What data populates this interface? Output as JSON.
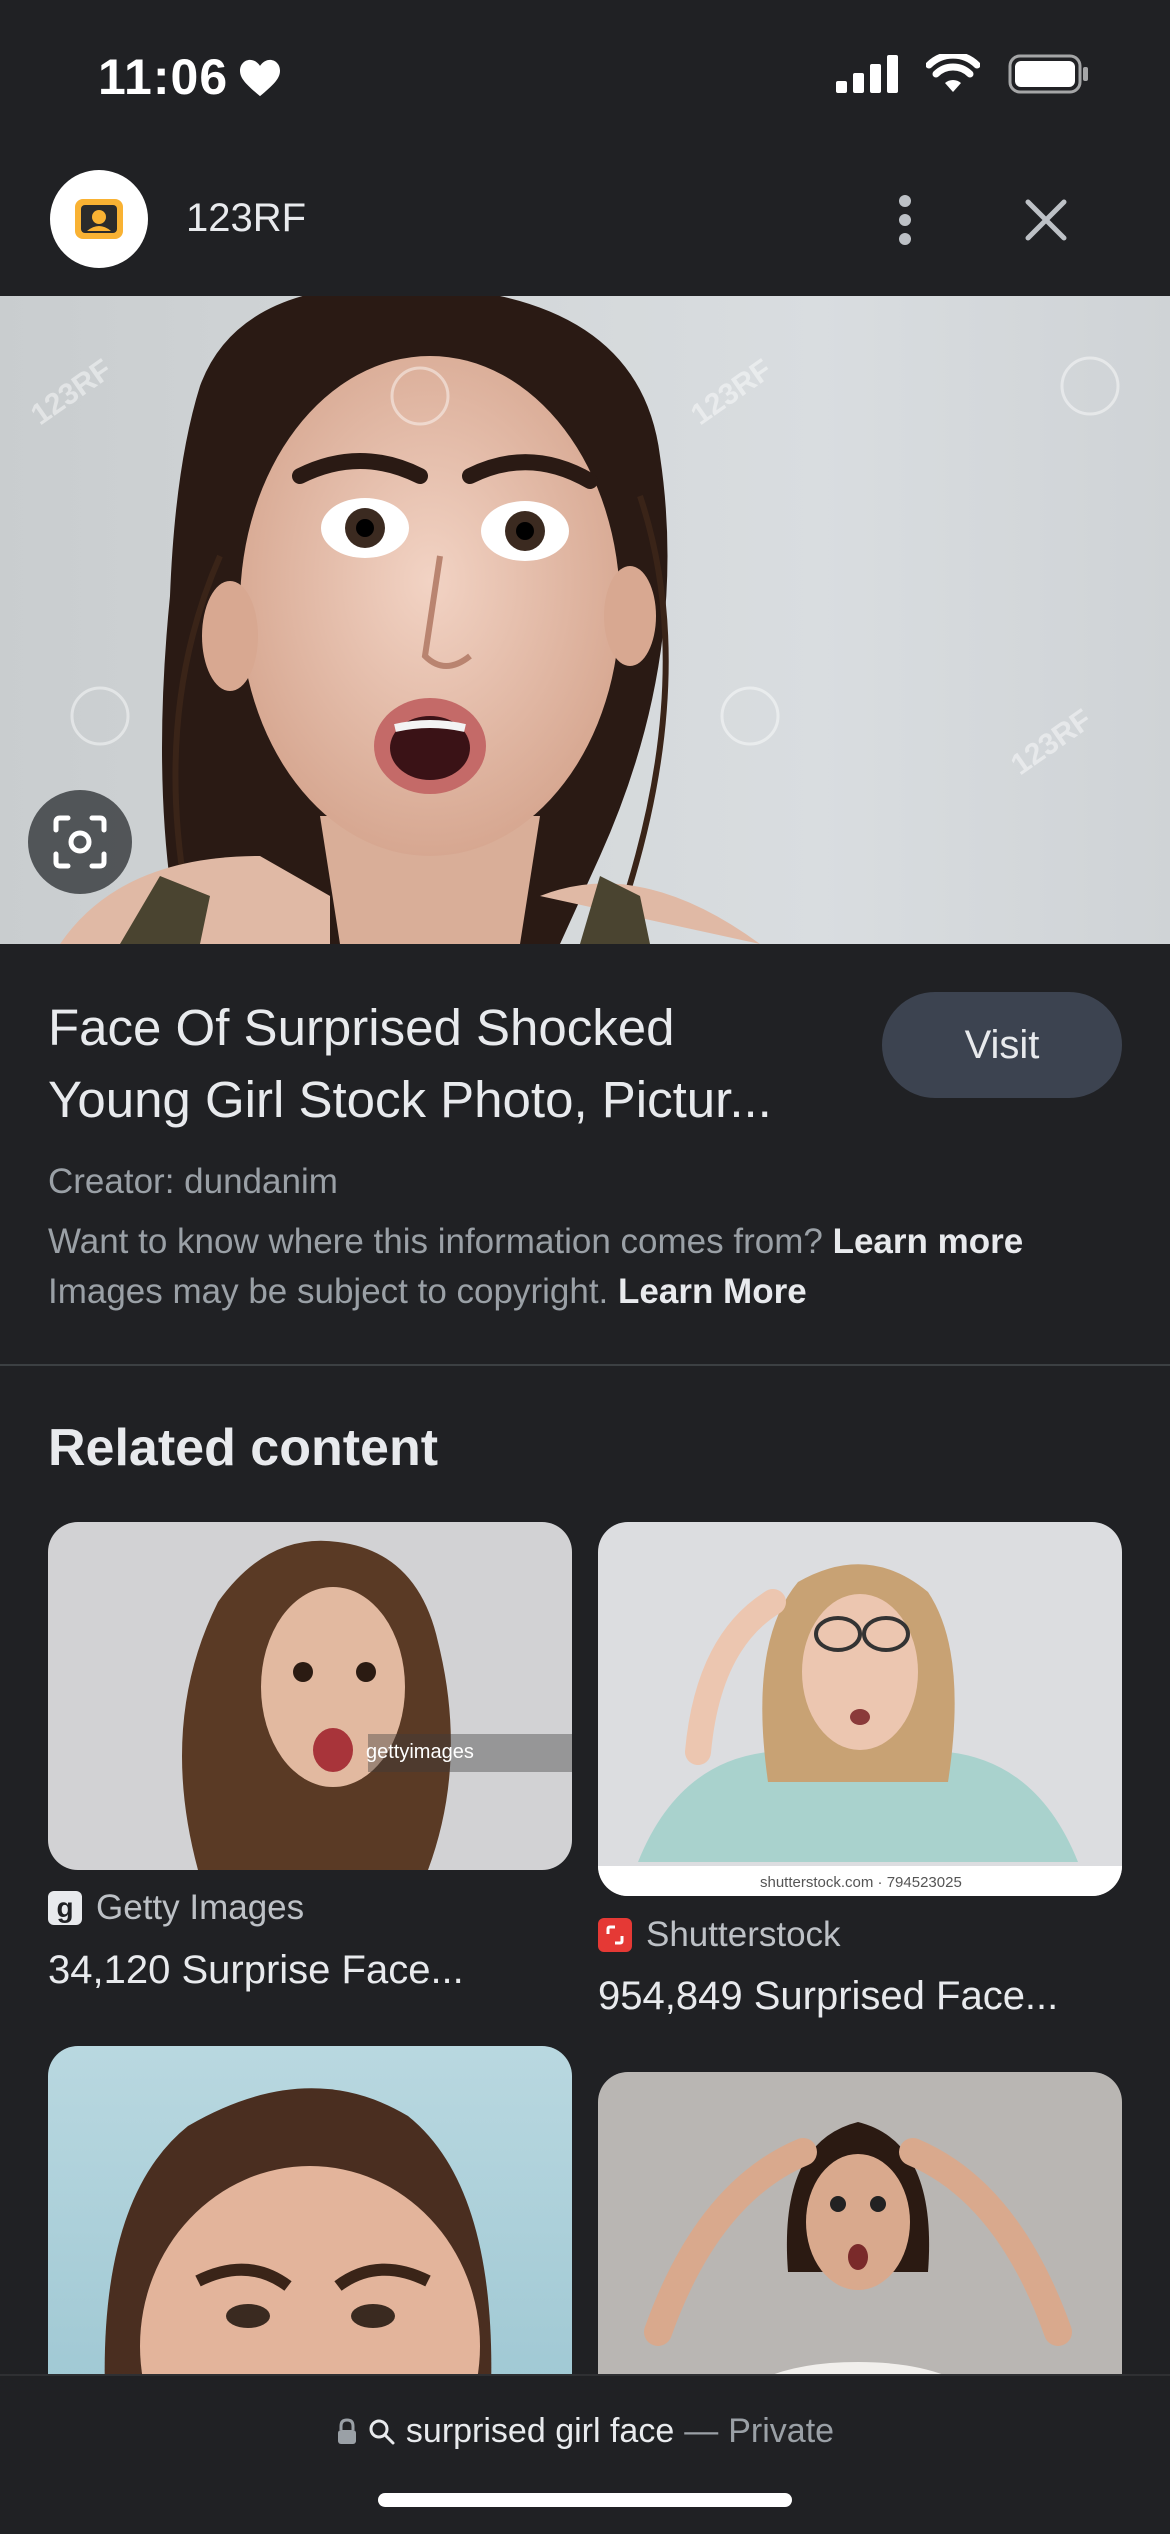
{
  "status": {
    "time": "11:06"
  },
  "header": {
    "site_name": "123RF",
    "logo_icon": "camera-icon"
  },
  "hero": {
    "watermark": "123RF"
  },
  "result": {
    "title_line1": "Face Of Surprised Shocked",
    "title_line2": "Young Girl Stock Photo, Pictur...",
    "visit_label": "Visit",
    "creator": "Creator: dundanim",
    "info_text": "Want to know where this information comes from?",
    "info_link": "Learn more",
    "copyright_text": "Images may be subject to copyright.",
    "copyright_link": "Learn More"
  },
  "related": {
    "title": "Related content",
    "cards": [
      {
        "source": "Getty Images",
        "caption": "34,120 Surprise Face...",
        "watermark": "gettyimages"
      },
      {
        "source": "Shutterstock",
        "caption": "954,849 Surprised Face...",
        "watermark": "shutterstock.com · 794523025"
      },
      {
        "source": "",
        "caption": ""
      },
      {
        "source": "",
        "caption": ""
      }
    ]
  },
  "bottom": {
    "query": "surprised girl face",
    "separator": "—",
    "mode": "Private"
  },
  "colors": {
    "background": "#202124",
    "button": "#3c4350",
    "text": "#e8eaed",
    "secondary": "#9aa0a6"
  }
}
